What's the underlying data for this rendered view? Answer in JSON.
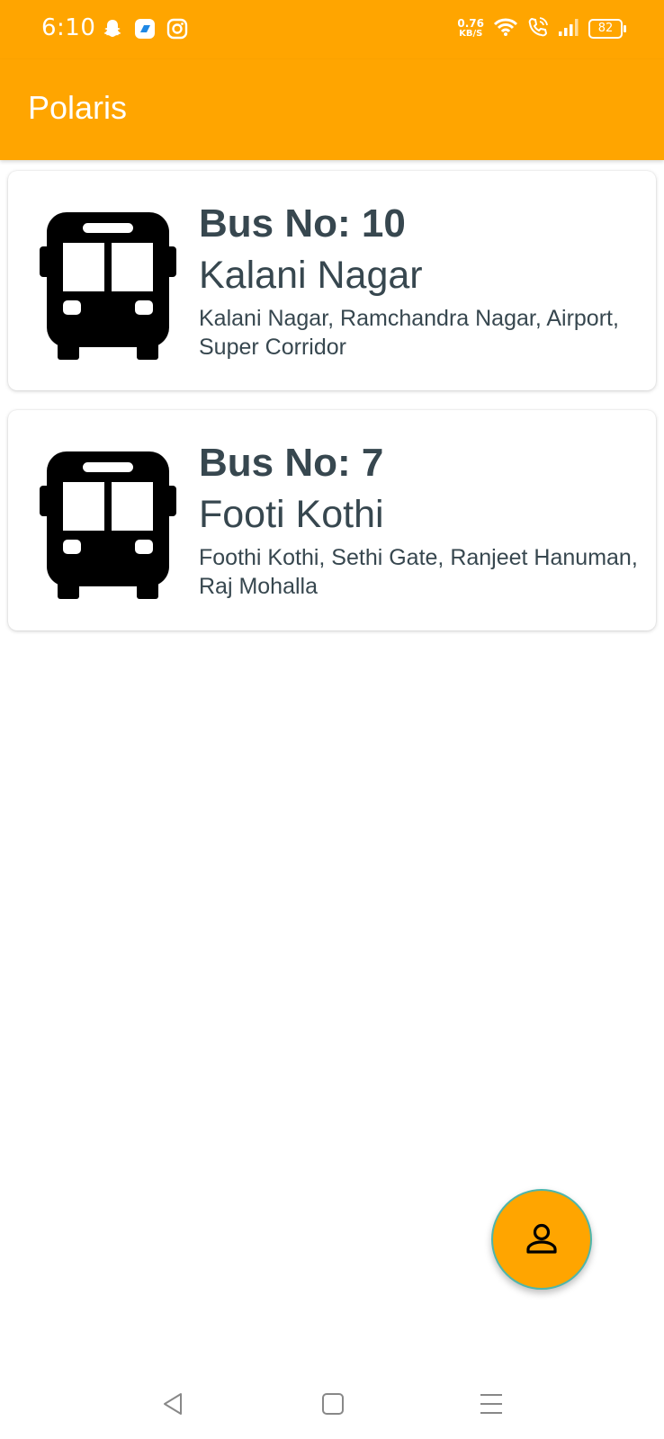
{
  "status_bar": {
    "time": "6:10",
    "speed_value": "0.76",
    "speed_unit": "KB/S",
    "battery": "82",
    "icons_left": [
      "snapchat-icon",
      "messenger-icon",
      "instagram-icon"
    ],
    "icons_right": [
      "wifi-icon",
      "wifi-call-icon",
      "signal-icon",
      "battery-icon"
    ]
  },
  "app_bar": {
    "title": "Polaris",
    "color": "#FFA500"
  },
  "buses": [
    {
      "bus_no": "Bus No: 10",
      "route_name": "Kalani Nagar",
      "stops": "Kalani Nagar,  Ramchandra Nagar,  Airport,  Super Corridor",
      "icon": "bus-icon"
    },
    {
      "bus_no": "Bus No: 7",
      "route_name": "Footi Kothi",
      "stops": "Foothi Kothi,  Sethi Gate,  Ranjeet Hanuman,  Raj Mohalla",
      "icon": "bus-icon"
    }
  ],
  "fab": {
    "icon": "person-icon",
    "color": "#FFA500"
  },
  "nav_bar": {
    "icons": [
      "back-icon",
      "home-icon",
      "menu-icon"
    ]
  }
}
